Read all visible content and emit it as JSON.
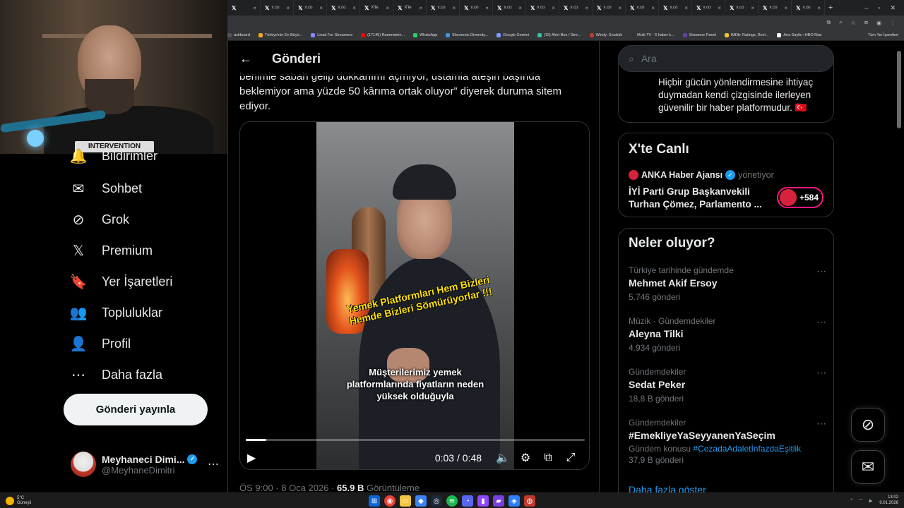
{
  "browser": {
    "tabs": [
      {
        "label": "",
        "logo": "𝕏"
      },
      {
        "label": "x.co",
        "logo": "𝕏"
      },
      {
        "label": "x.co",
        "logo": "𝕏"
      },
      {
        "label": "x.co",
        "logo": "𝕏"
      },
      {
        "label": "X'te",
        "logo": "𝕏"
      },
      {
        "label": "X'te",
        "logo": "𝕏"
      },
      {
        "label": "x.co",
        "logo": "𝕏"
      },
      {
        "label": "x.co",
        "logo": "𝕏"
      },
      {
        "label": "x.co",
        "logo": "𝕏"
      },
      {
        "label": "x.co",
        "logo": "𝕏"
      },
      {
        "label": "x.co",
        "logo": "𝕏"
      },
      {
        "label": "x.co",
        "logo": "𝕏"
      },
      {
        "label": "x.co",
        "logo": "𝕏"
      },
      {
        "label": "x.co",
        "logo": "𝕏"
      },
      {
        "label": "x.co",
        "logo": "𝕏"
      },
      {
        "label": "x.co",
        "logo": "𝕏"
      },
      {
        "label": "x.co",
        "logo": "𝕏"
      },
      {
        "label": "x.co",
        "logo": "𝕏"
      }
    ],
    "bookmarks": [
      {
        "label": "ashboard",
        "color": "#555555"
      },
      {
        "label": "Türkiye'nin En Büyü...",
        "color": "#f5a623"
      },
      {
        "label": "Livad For Streamers",
        "color": "#8888ff"
      },
      {
        "label": "(17145) Rammstein...",
        "color": "#ff0000"
      },
      {
        "label": "WhatsApp",
        "color": "#25d366"
      },
      {
        "label": "Electronic Diversity...",
        "color": "#4a90e2"
      },
      {
        "label": "Google Gemini",
        "color": "#7b9cff"
      },
      {
        "label": "(19) Alert Box / Stre...",
        "color": "#31c3a2"
      },
      {
        "label": "Windy: Sıcaklık",
        "color": "#c0392b"
      },
      {
        "label": "Multi TV - 6 haber k...",
        "color": "#333333"
      },
      {
        "label": "Streamer Panel",
        "color": "#6441a5"
      },
      {
        "label": "IMDb: Ratings, Revi...",
        "color": "#f5c518"
      },
      {
        "label": "Ana Sayfa • HBO Max",
        "color": "#ffffff"
      }
    ],
    "all_bookmarks": "Tüm Yer İşaretleri"
  },
  "webcam": {
    "shirt_text": "INTERVENTION"
  },
  "nav": {
    "items": [
      {
        "label": "Bildirimler",
        "icon": "bell-icon",
        "glyph": "🔔"
      },
      {
        "label": "Sohbet",
        "icon": "mail-icon",
        "glyph": "✉"
      },
      {
        "label": "Grok",
        "icon": "grok-icon",
        "glyph": "⊘"
      },
      {
        "label": "Premium",
        "icon": "x-logo-icon",
        "glyph": "𝕏"
      },
      {
        "label": "Yer İşaretleri",
        "icon": "bookmark-icon",
        "glyph": "🔖"
      },
      {
        "label": "Topluluklar",
        "icon": "communities-icon",
        "glyph": "👥"
      },
      {
        "label": "Profil",
        "icon": "profile-icon",
        "glyph": "👤"
      },
      {
        "label": "Daha fazla",
        "icon": "more-circle-icon",
        "glyph": "⋯"
      }
    ],
    "post_button": "Gönderi yayınla",
    "account": {
      "name": "Meyhaneci Dimi...",
      "handle": "@MeyhaneDimitri"
    }
  },
  "main": {
    "header_title": "Gönderi",
    "post_text": "benimle sabah gelip dükkanımı açmıyor, ustamla ateşin başında beklemiyor ama yüzde 50 kârıma ortak oluyor” diyerek duruma sitem ediyor.",
    "video": {
      "overlay_yellow": "Yemek Platformları Hem Bizleri Hemde Bizleri Sömürüyorlar !!!",
      "subtitle": "Müşterilerimiz yemek platformlarında fiyatların neden yüksek olduğuyla",
      "time": "0:03 / 0:48",
      "progress_percent": 6
    },
    "meta": {
      "time": "ÖS 9:00 · 8 Oca 2026 · ",
      "views": "65.9 B",
      "views_label": " Görüntüleme"
    }
  },
  "right": {
    "search_placeholder": "Ara",
    "about_text": "Hiçbir gücün yönlendirmesine ihtiyaç duymadan kendi çizgisinde ilerleyen güvenilir bir haber platformudur. 🇹🇷",
    "live": {
      "title": "X'te Canlı",
      "host": "ANKA Haber Ajansı",
      "role": "yönetiyor",
      "space_title": "İYİ Parti Grup Başkanvekili Turhan Çömez, Parlamento ...",
      "listeners": "+584"
    },
    "trends": {
      "title": "Neler oluyor?",
      "items": [
        {
          "context": "Türkiye tarihinde gündemde",
          "name": "Mehmet Akif Ersoy",
          "count": "5.746 gönderi"
        },
        {
          "context": "Müzik · Gündemdekiler",
          "name": "Aleyna Tilki",
          "count": "4.934 gönderi"
        },
        {
          "context": "Gündemdekiler",
          "name": "Sedat Peker",
          "count": "18,8 B gönderi"
        },
        {
          "context": "Gündemdekiler",
          "name": "#EmekliyeYaSeyyanenYaSeçim",
          "topic_prefix": "Gündem konusu ",
          "topic_link": "#CezadaAdaletİnfazdaEşitlik",
          "count": "37,9 B gönderi"
        }
      ],
      "show_more": "Daha fazla göster"
    }
  },
  "taskbar": {
    "weather_temp": "5°C",
    "weather_desc": "Güneşli",
    "time": "13:02",
    "date": "9.01.2026"
  }
}
